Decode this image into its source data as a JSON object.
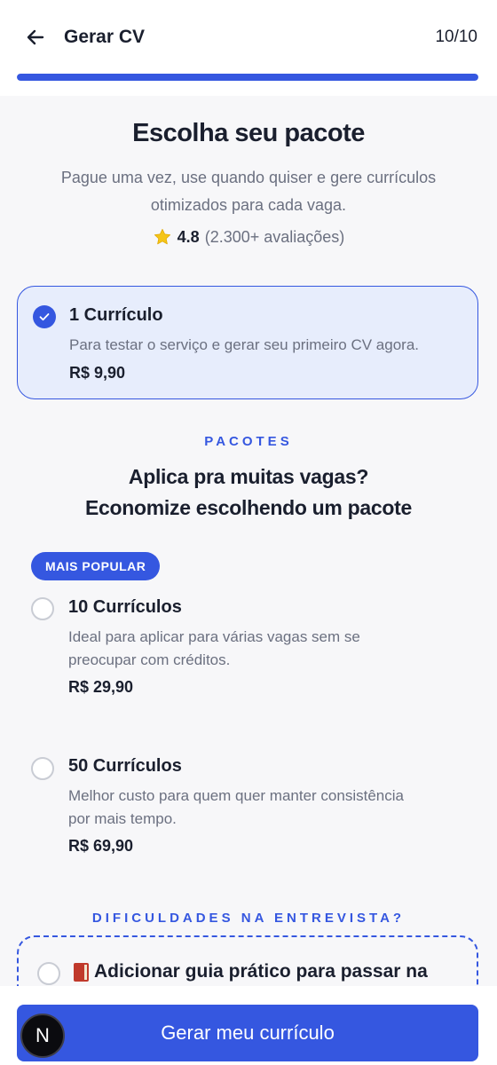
{
  "header": {
    "title": "Gerar CV",
    "step": "10/10",
    "progress": 1.0,
    "back_icon": "arrow-left-icon"
  },
  "intro": {
    "title": "Escolha seu pacote",
    "subtitle_line1": "Pague uma vez, use quando quiser e gere currículos",
    "subtitle_line2": "otimizados para cada vaga.",
    "rating_score": "4.8",
    "rating_count": "(2.300+ avaliações)",
    "rating_icon": "star-icon"
  },
  "single": {
    "title": "1 Currículo",
    "description": "Para testar o serviço e gerar seu primeiro CV agora.",
    "price": "R$ 9,90",
    "selected": true
  },
  "packages": {
    "label": "PACOTES",
    "title_line1": "Aplica pra muitas vagas?",
    "title_line2": "Economize escolhendo um pacote",
    "badge": "MAIS POPULAR",
    "options": [
      {
        "title": "10 Currículos",
        "desc_line1": "Ideal para aplicar para várias vagas sem se",
        "desc_line2": "preocupar com créditos.",
        "price": "R$ 29,90"
      },
      {
        "title": "50 Currículos",
        "desc_line1": "Melhor custo para quem quer manter consistência",
        "desc_line2": "por mais tempo.",
        "price": "R$ 69,90"
      }
    ]
  },
  "addon": {
    "section_label": "DIFICULDADES NA ENTREVISTA?",
    "label": "Adicionar guia prático para passar na",
    "icon": "book-icon"
  },
  "footer": {
    "cta": "Gerar meu currículo",
    "logo_letter": "N"
  },
  "colors": {
    "accent": "#3557e0",
    "selected_bg": "#e7edfc",
    "text": "#1a1f2e",
    "muted": "#6b7080",
    "star": "#f5c518"
  }
}
